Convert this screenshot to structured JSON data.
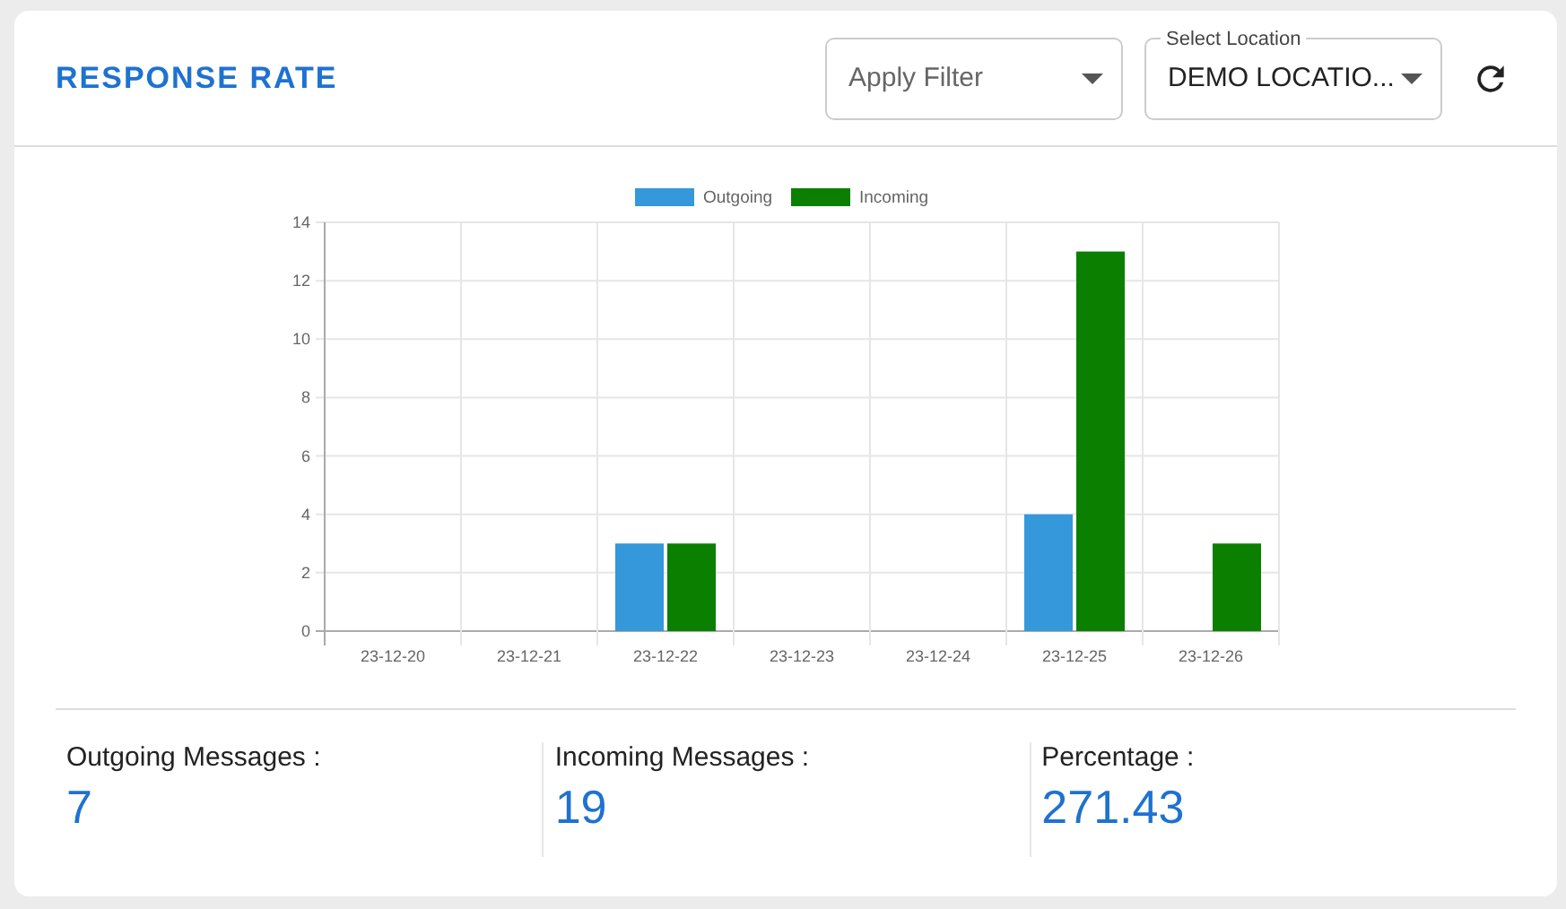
{
  "title": "RESPONSE RATE",
  "filter": {
    "placeholder": "Apply Filter"
  },
  "location": {
    "label": "Select Location",
    "value": "DEMO LOCATIO..."
  },
  "chart_data": {
    "type": "bar",
    "grid": true,
    "legend": true,
    "categories": [
      "23-12-20",
      "23-12-21",
      "23-12-22",
      "23-12-23",
      "23-12-24",
      "23-12-25",
      "23-12-26"
    ],
    "ylim": [
      0,
      14
    ],
    "yticks": [
      0,
      2,
      4,
      6,
      8,
      10,
      12,
      14
    ],
    "series": [
      {
        "name": "Outgoing",
        "color": "#3498db",
        "values": [
          0,
          0,
          3,
          0,
          0,
          4,
          0
        ]
      },
      {
        "name": "Incoming",
        "color": "#0a7f00",
        "values": [
          0,
          0,
          3,
          0,
          0,
          13,
          3
        ]
      }
    ]
  },
  "stats": [
    {
      "label": "Outgoing Messages :",
      "value": "7"
    },
    {
      "label": "Incoming Messages :",
      "value": "19"
    },
    {
      "label": "Percentage :",
      "value": "271.43"
    }
  ]
}
